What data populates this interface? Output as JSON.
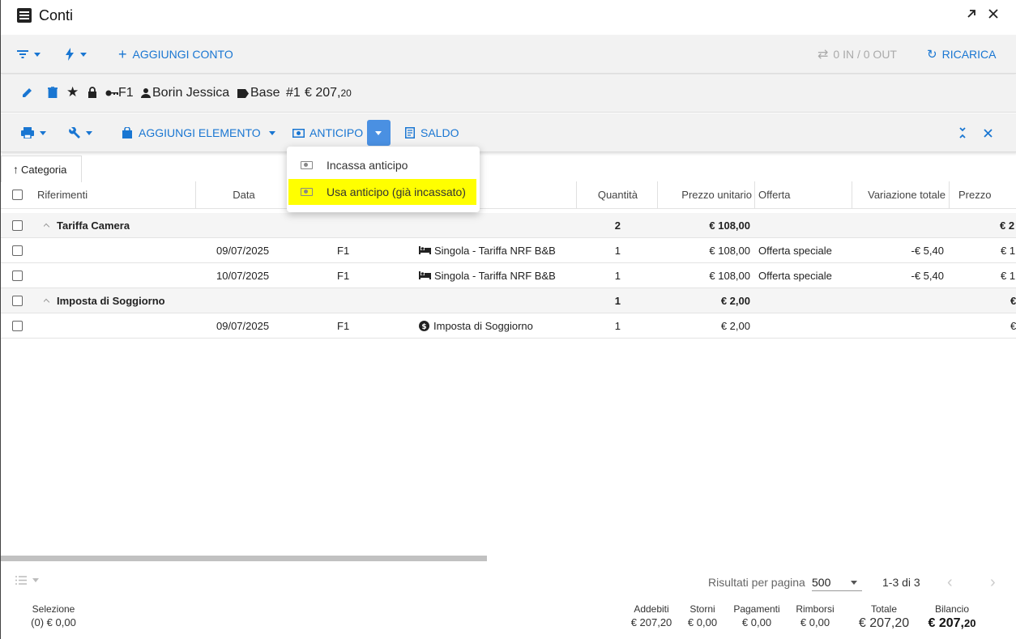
{
  "window": {
    "title": "Conti"
  },
  "toolbar": {
    "add_account_label": "AGGIUNGI CONTO",
    "in_out_label": "0 IN / 0 OUT",
    "reload_label": "RICARICA"
  },
  "account_header": {
    "key_label": "F1",
    "guest_name": "Borin Jessica",
    "tag_label": "Base",
    "number_label": "#1",
    "amount_main": "€ 207,",
    "amount_cents": "20"
  },
  "action_bar": {
    "add_item_label": "AGGIUNGI ELEMENTO",
    "advance_label": "ANTICIPO",
    "balance_label": "SALDO"
  },
  "dropdown": {
    "items": [
      {
        "label": "Incassa anticipo"
      },
      {
        "label": "Usa anticipo (già incassato)"
      }
    ]
  },
  "category_tab": {
    "label": "Categoria"
  },
  "table": {
    "columns": {
      "riferimenti": "Riferimenti",
      "data": "Data",
      "quantita": "Quantità",
      "prezzo_unitario": "Prezzo unitario",
      "offerta": "Offerta",
      "variazione": "Variazione totale",
      "prezzo": "Prezzo"
    },
    "rows": [
      {
        "kind": "group",
        "name": "Tariffa Camera",
        "qty": "2",
        "unit": "€ 108,00",
        "price": "€ 2"
      },
      {
        "kind": "item",
        "date": "09/07/2025",
        "ref": "F1",
        "desc": "Singola - Tariffa NRF B&B",
        "icon": "bed-icon",
        "qty": "1",
        "unit": "€ 108,00",
        "offer": "Offerta speciale",
        "var": "-€ 5,40",
        "price": "€ 1"
      },
      {
        "kind": "item",
        "date": "10/07/2025",
        "ref": "F1",
        "desc": "Singola - Tariffa NRF B&B",
        "icon": "bed-icon",
        "qty": "1",
        "unit": "€ 108,00",
        "offer": "Offerta speciale",
        "var": "-€ 5,40",
        "price": "€ 1"
      },
      {
        "kind": "group",
        "name": "Imposta di Soggiorno",
        "qty": "1",
        "unit": "€ 2,00",
        "price": "€"
      },
      {
        "kind": "item",
        "date": "09/07/2025",
        "ref": "F1",
        "desc": "Imposta di Soggiorno",
        "icon": "dollar-icon",
        "qty": "1",
        "unit": "€ 2,00",
        "offer": "",
        "var": "",
        "price": "€"
      }
    ]
  },
  "pager": {
    "per_page_label": "Risultati per pagina",
    "per_page_value": "500",
    "range_label": "1-3 di 3"
  },
  "totals": {
    "selection_label": "Selezione",
    "selection_value": "(0) € 0,00",
    "charges_label": "Addebiti",
    "charges_value": "€ 207,20",
    "reversals_label": "Storni",
    "reversals_value": "€ 0,00",
    "payments_label": "Pagamenti",
    "payments_value": "€ 0,00",
    "refunds_label": "Rimborsi",
    "refunds_value": "€ 0,00",
    "total_label": "Totale",
    "total_value": "€ 207,20",
    "balance_label": "Bilancio",
    "balance_main": "€ 207,",
    "balance_cents": "20"
  },
  "colors": {
    "accent": "#1976d2",
    "highlight": "#ffff00",
    "split_button": "#4a90e2"
  }
}
